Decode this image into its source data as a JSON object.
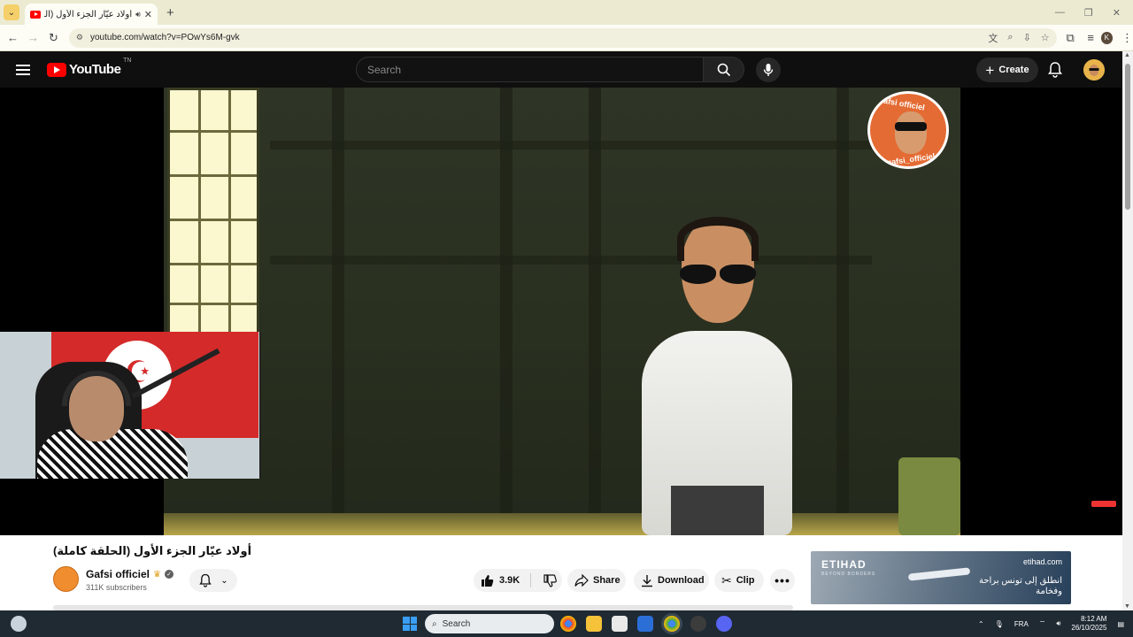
{
  "browser": {
    "tab": {
      "title": "أولاد عيّار الجزء الأول (الحلقة كاملة)",
      "favicon": "youtube-icon"
    },
    "url": "youtube.com/watch?v=POwYs6M-gvk",
    "profile_initial": "K"
  },
  "youtube": {
    "logo_text": "YouTube",
    "logo_country": "TN",
    "search": {
      "placeholder": "Search"
    },
    "create_label": "Create"
  },
  "video": {
    "overlay_badge": {
      "top_text": "Gafsi officiel",
      "bottom_text": "el_gafsi_officiel"
    }
  },
  "details": {
    "title": "أولاد عيّار الجزء الأول (الحلقة كاملة)",
    "channel": {
      "name": "Gafsi officiel",
      "subscribers": "311K subscribers"
    },
    "actions": {
      "likes": "3.9K",
      "share": "Share",
      "download": "Download",
      "clip": "Clip"
    }
  },
  "ad": {
    "brand": "ETIHAD",
    "tagline": "BEYOND BORDERS",
    "domain": "etihad.com",
    "text": "انطلق إلى تونس براحة وفخامة"
  },
  "taskbar": {
    "search_placeholder": "Search",
    "language": "FRA",
    "time": "8:12 AM",
    "date": "26/10/2025"
  },
  "colors": {
    "youtube_red": "#ff0000",
    "page_bg": "#0f0f0f",
    "chrome_tabstrip": "#ecebd2"
  }
}
